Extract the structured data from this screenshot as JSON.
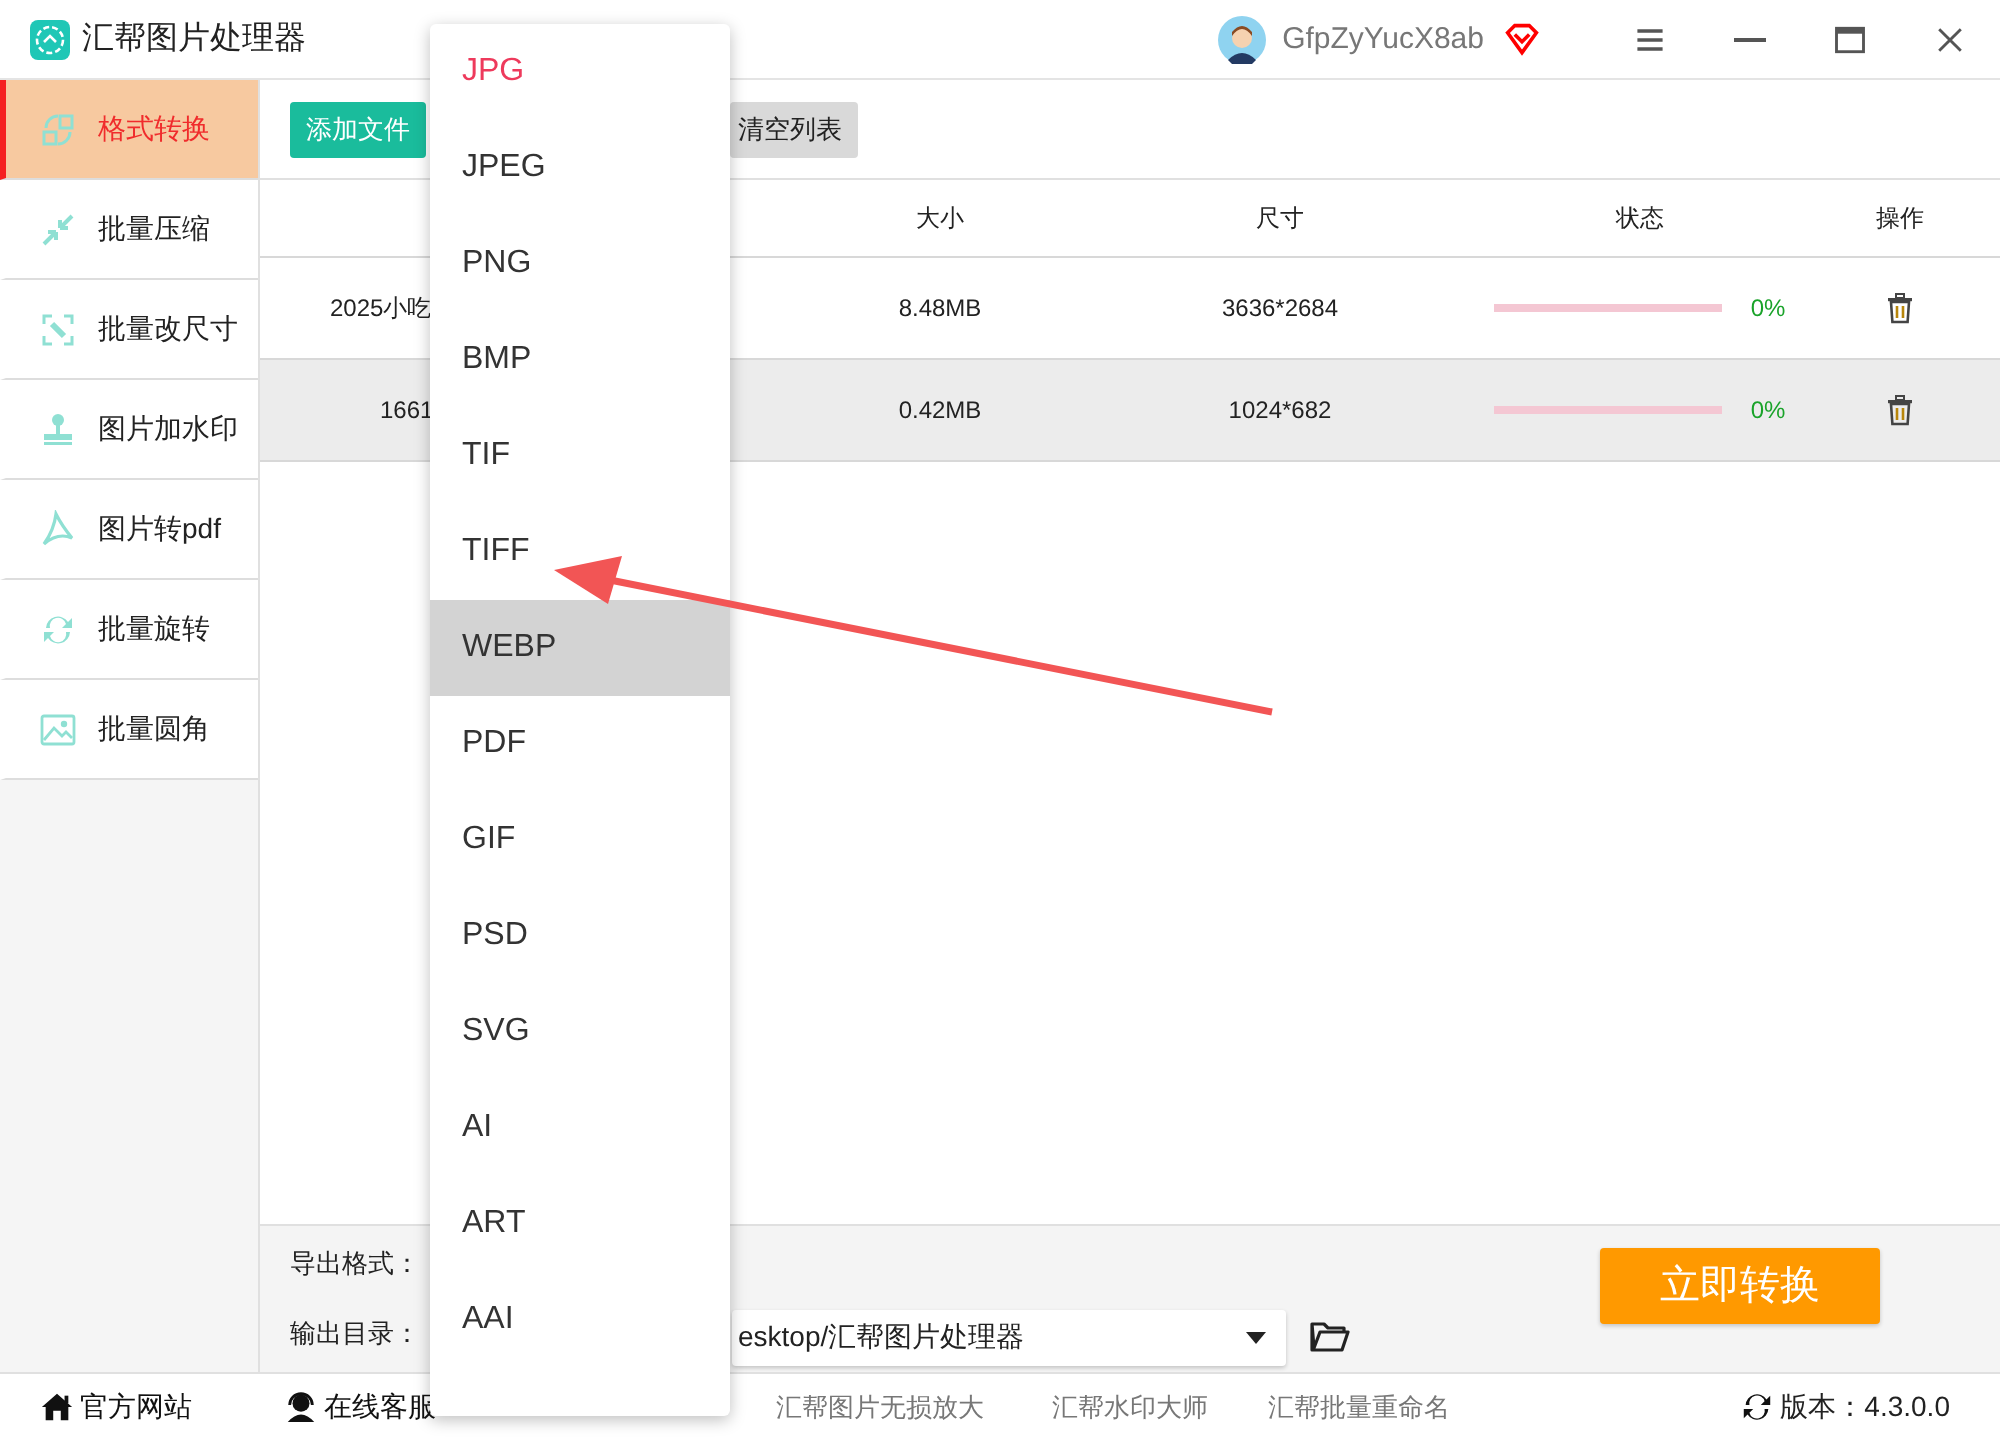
{
  "window": {
    "title": "汇帮图片处理器",
    "user": "GfpZyYucX8ab"
  },
  "sidebar": {
    "items": [
      {
        "label": "格式转换",
        "selected": true
      },
      {
        "label": "批量压缩",
        "selected": false
      },
      {
        "label": "批量改尺寸",
        "selected": false
      },
      {
        "label": "图片加水印",
        "selected": false
      },
      {
        "label": "图片转pdf",
        "selected": false
      },
      {
        "label": "批量旋转",
        "selected": false
      },
      {
        "label": "批量圆角",
        "selected": false
      }
    ]
  },
  "toolbar": {
    "buttons": [
      {
        "label": "添加文件",
        "kind": "primary"
      },
      {
        "label": "清空列表",
        "kind": "secondary"
      }
    ]
  },
  "table": {
    "columns": [
      "大小",
      "尺寸",
      "状态",
      "操作"
    ],
    "rows": [
      {
        "name": "2025小吃",
        "size": "8.48MB",
        "dimensions": "3636*2684",
        "level": 0,
        "progress": "0%",
        "selected": false
      },
      {
        "name": "1661",
        "size": "0.42MB",
        "dimensions": "1024*682",
        "level": 0,
        "progress": "0%",
        "selected": true
      }
    ]
  },
  "output": {
    "format_label": "导出格式：",
    "dir_label": "输出目录：",
    "dir_value": "esktop/汇帮图片处理器"
  },
  "convert_button": "立即转换",
  "footer": {
    "links": [
      {
        "label": "官方网站",
        "kind": "home"
      },
      {
        "label": "在线客服",
        "kind": "support"
      },
      {
        "label": "汇帮图片无损放大",
        "kind": "plain"
      },
      {
        "label": "汇帮水印大师",
        "kind": "plain"
      },
      {
        "label": "汇帮批量重命名",
        "kind": "plain"
      }
    ],
    "version": "版本：4.3.0.0"
  },
  "format_menu": {
    "items": [
      {
        "label": "JPG",
        "selected": true,
        "highlighted": false
      },
      {
        "label": "JPEG",
        "selected": false,
        "highlighted": false
      },
      {
        "label": "PNG",
        "selected": false,
        "highlighted": false
      },
      {
        "label": "BMP",
        "selected": false,
        "highlighted": false
      },
      {
        "label": "TIF",
        "selected": false,
        "highlighted": false
      },
      {
        "label": "TIFF",
        "selected": false,
        "highlighted": false
      },
      {
        "label": "WEBP",
        "selected": false,
        "highlighted": true
      },
      {
        "label": "PDF",
        "selected": false,
        "highlighted": false
      },
      {
        "label": "GIF",
        "selected": false,
        "highlighted": false
      },
      {
        "label": "PSD",
        "selected": false,
        "highlighted": false
      },
      {
        "label": "SVG",
        "selected": false,
        "highlighted": false
      },
      {
        "label": "AI",
        "selected": false,
        "highlighted": false
      },
      {
        "label": "ART",
        "selected": false,
        "highlighted": false
      },
      {
        "label": "AAI",
        "selected": false,
        "highlighted": false
      }
    ]
  }
}
